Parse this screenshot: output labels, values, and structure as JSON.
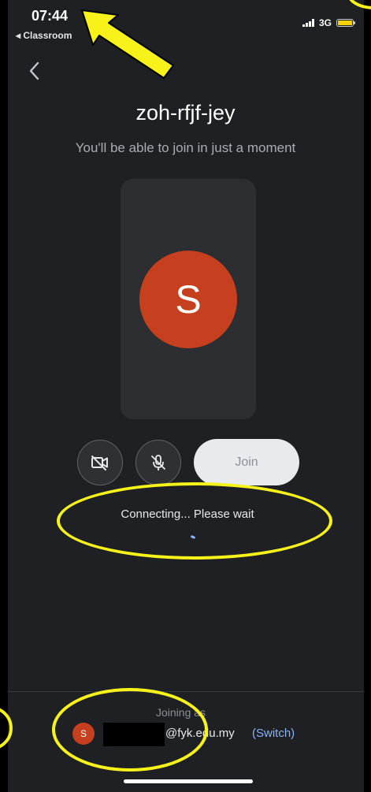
{
  "status_bar": {
    "time": "07:44",
    "back_app": "◂ Classroom",
    "network": "3G"
  },
  "meeting": {
    "code": "zoh-rfjf-jey",
    "subtitle": "You'll be able to join in just a moment",
    "avatar_initial": "S",
    "avatar_color": "#c6401f"
  },
  "controls": {
    "camera_icon": "camera-off-icon",
    "mic_icon": "mic-off-icon",
    "join_label": "Join"
  },
  "status": {
    "connecting": "Connecting... Please wait"
  },
  "account": {
    "joining_label": "Joining as",
    "avatar_initial": "S",
    "email": "@fyk.edu.my",
    "switch_label": "(Switch)"
  },
  "colors": {
    "background": "#1f2023",
    "annotation": "#f7f21a",
    "link": "#8ab4f8"
  }
}
